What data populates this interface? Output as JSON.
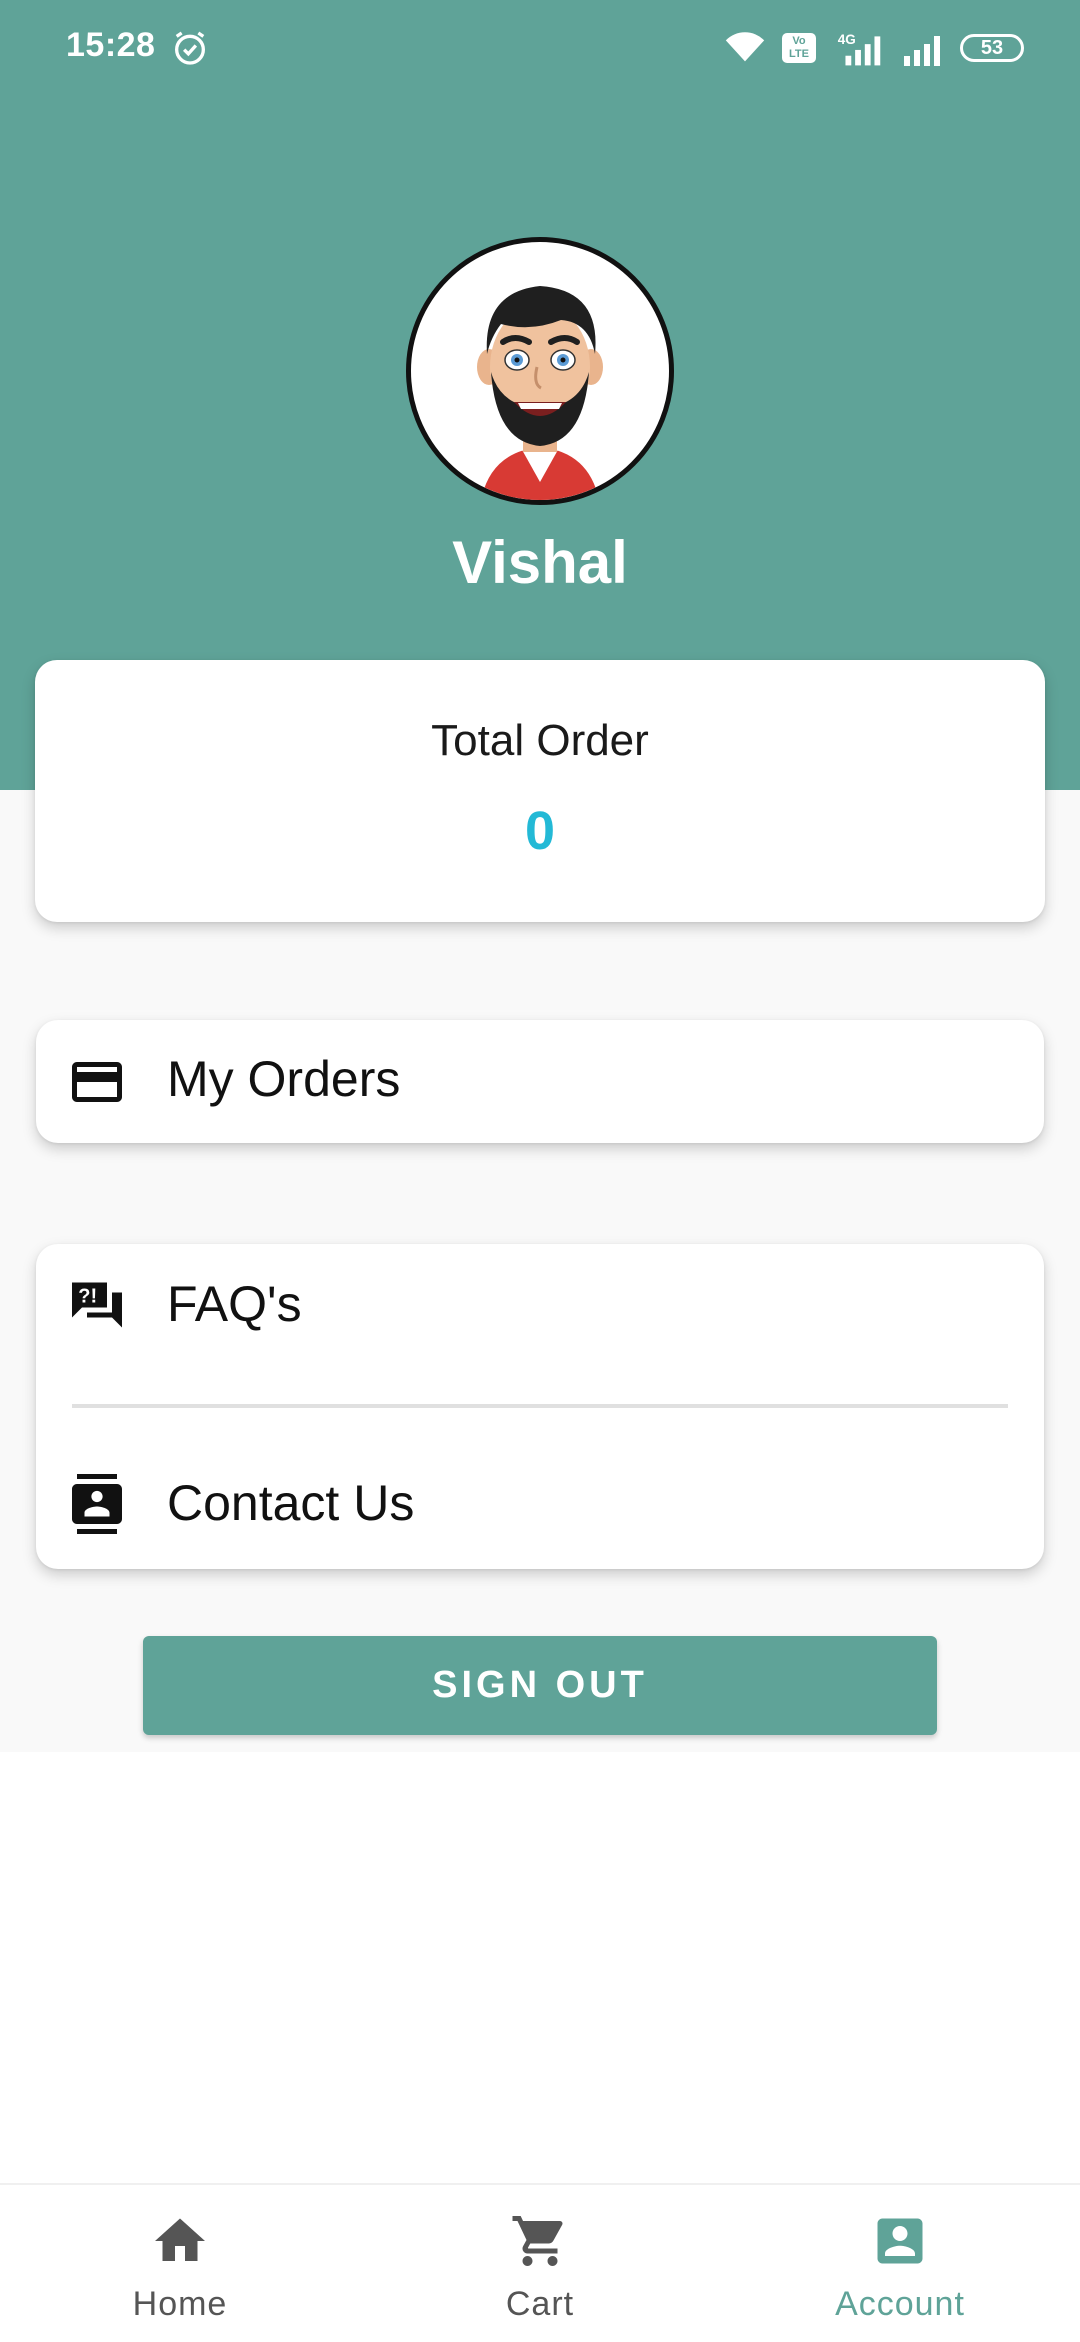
{
  "status_bar": {
    "time": "15:28",
    "network": "4G",
    "volte": "Vo LTE",
    "battery": "53"
  },
  "profile": {
    "name": "Vishal"
  },
  "summary": {
    "label": "Total Order",
    "value": "0"
  },
  "menu": {
    "my_orders": "My Orders",
    "faqs": "FAQ's",
    "contact_us": "Contact Us"
  },
  "actions": {
    "sign_out": "SIGN OUT"
  },
  "bottom_nav": {
    "items": [
      {
        "label": "Home",
        "icon": "home-icon"
      },
      {
        "label": "Cart",
        "icon": "cart-icon"
      },
      {
        "label": "Account",
        "icon": "account-icon",
        "active": true
      }
    ]
  },
  "colors": {
    "primary": "#5fa398",
    "accent": "#23b9d6",
    "background": "#f9f9f9"
  }
}
